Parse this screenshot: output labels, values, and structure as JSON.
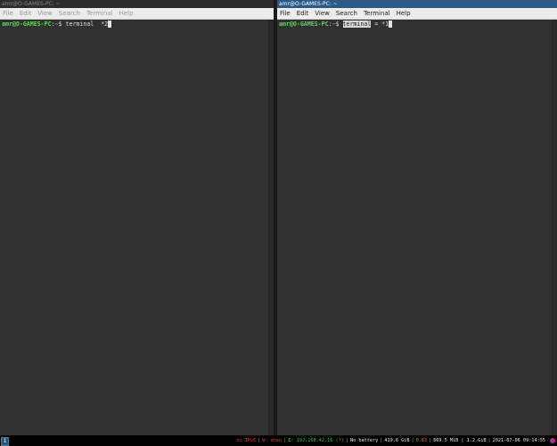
{
  "windows": {
    "left": {
      "title": "amr@O-GAMES-PC: ~",
      "menu": [
        "File",
        "Edit",
        "View",
        "Search",
        "Terminal",
        "Help"
      ],
      "prompt_user": "amr@O-GAMES-PC",
      "prompt_sep": ":",
      "prompt_path": "~",
      "prompt_symbol": "$",
      "command_text": "terminal  *2",
      "cursor_char": " "
    },
    "right": {
      "title": "amr@O-GAMES-PC: ~",
      "menu": [
        "File",
        "Edit",
        "View",
        "Search",
        "Terminal",
        "Help"
      ],
      "prompt_user": "amr@O-GAMES-PC",
      "prompt_sep": ":",
      "prompt_path": "~",
      "prompt_symbol": "$",
      "command_selected": "terminal",
      "command_rest": " = *1",
      "cursor_char": " "
    }
  },
  "statusbar": {
    "workspace": "1",
    "ipv6": "no IPv6",
    "wifi": "W: down",
    "ethernet": "E: 192.168.42.16 (?)",
    "battery": "No battery",
    "disk": "419.6 GiB",
    "load": "0.83",
    "memory": "669.5 MiB | 1.2 GiB",
    "datetime": "2021-07-06 09:14:55"
  },
  "colors": {
    "active_title": "#2a5a87",
    "prompt_user": "#5fd75f",
    "prompt_path": "#5f87ff",
    "terminal_bg": "#303030"
  }
}
